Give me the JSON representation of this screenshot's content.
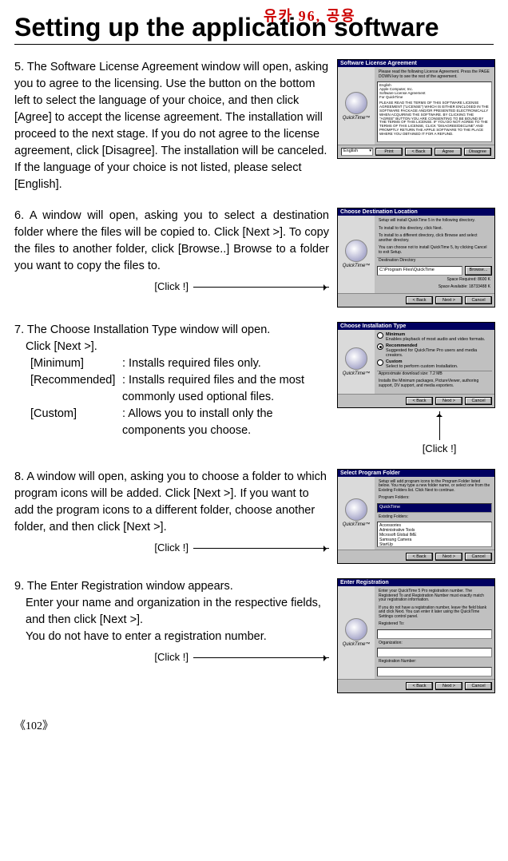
{
  "watermark": "유카 96, 공용",
  "title": "Setting up the application software",
  "steps": {
    "s5": {
      "num": "5.",
      "text": "The Software License Agreement window will open, asking you to agree to the licensing. Use the button on the bottom left to select the language of your choice, and then click [Agree] to accept the license agreement. The installation will proceed to the next stage. If you do not agree to the license agreement, click [Disagree]. The installation will be canceled. If the language of your choice is not listed, please select [English]."
    },
    "s6": {
      "num": "6.",
      "text": "A window will open, asking you to select a destination folder where the files will be copied to. Click [Next >]. To copy the files to another folder, click [Browse..] Browse to a folder you want to copy the files to.",
      "click": "[Click !]"
    },
    "s7": {
      "num": "7.",
      "line1": "The Choose Installation Type window will open.",
      "line2": "Click [Next >].",
      "options": [
        {
          "label": "[Minimum]",
          "desc": ": Installs required files only."
        },
        {
          "label": "[Recommended]",
          "desc": ": Installs required files and the most commonly used optional files."
        },
        {
          "label": "[Custom]",
          "desc": ": Allows you to install only the components you choose."
        }
      ],
      "click": "[Click !]"
    },
    "s8": {
      "num": "8.",
      "text": "A window will open, asking you to choose a folder to which program icons will be added. Click [Next >]. If you want to add the program icons to a different folder, choose another folder, and then click [Next >].",
      "click": "[Click !]"
    },
    "s9": {
      "num": "9.",
      "line1": "The Enter Registration window appears.",
      "line2": "Enter your name and organization in the respective fields, and then click [Next >].",
      "line3": "You do not have to enter a registration number.",
      "click": "[Click !]"
    }
  },
  "dialogs": {
    "d5": {
      "title": "Software License Agreement",
      "note": "Please read the following License Agreement. Press the PAGE DOWN key to see the rest of the agreement.",
      "license_top": "English\nApple Computer, Inc.\nSoftware License Agreement\nFor QuickTime",
      "license_body": "PLEASE READ THE TERMS OF THIS SOFTWARE LICENSE AGREEMENT (\"LICENSE\") WHICH IS EITHER ENCLOSED IN THE SOFTWARE PACKAGE AND/OR PRESENTED ELECTRONICALLY WHEN ACQUIRING THE SOFTWARE. BY CLICKING THE \"AGREE\" BUTTON YOU ARE CONSENTING TO BE BOUND BY THE TERMS OF THIS LICENSE. IF YOU DO NOT AGREE TO THE TERMS OF THIS LICENSE, CLICK \"DISAGREE/DECLINE\" AND PROMPTLY RETURN THE APPLE SOFTWARE TO THE PLACE WHERE YOU OBTAINED IT FOR A REFUND.",
      "lang": "English",
      "buttons": [
        "Print",
        "< Back",
        "Agree",
        "Disagree"
      ],
      "qt": "QuickTime™"
    },
    "d6": {
      "title": "Choose Destination Location",
      "note1": "Setup will install QuickTime 5 in the following directory.",
      "note2": "To install to this directory, click Next.",
      "note3": "To install to a different directory, click Browse and select another directory.",
      "note4": "You can choose not to install QuickTime 5, by clicking Cancel to exit Setup.",
      "dest_label": "Destination Directory",
      "dest_path": "C:\\Program Files\\QuickTime",
      "browse": "Browse...",
      "space1": "Space Required:   8600 K",
      "space2": "Space Available:  18733488 K",
      "buttons": [
        "< Back",
        "Next >",
        "Cancel"
      ],
      "qt": "QuickTime™"
    },
    "d7": {
      "title": "Choose Installation Type",
      "opt1_title": "Minimum",
      "opt1_desc": "Enables playback of most audio and video formats.",
      "opt2_title": "Recommended",
      "opt2_desc": "Suggested for QuickTime Pro users and media creators.",
      "opt3_title": "Custom",
      "opt3_desc": "Select to perform custom Installation.",
      "approx": "Approximate download size: 7.2 MB",
      "installs": "Installs the Minimum packages, PictureViewer, authoring support, DV support, and media exporters.",
      "buttons": [
        "< Back",
        "Next >",
        "Cancel"
      ],
      "qt": "QuickTime™"
    },
    "d8": {
      "title": "Select Program Folder",
      "note": "Setup will add program icons to the Program Folder listed below. You may type a new folder name, or select one from the Existing Folders list. Click Next to continue.",
      "pf_label": "Program Folders:",
      "pf_value": "QuickTime",
      "ef_label": "Existing Folders:",
      "ef_items": [
        "Accessories",
        "Administrative Tools",
        "Microsoft Global IME",
        "Samsung Camera",
        "StartUp"
      ],
      "buttons": [
        "< Back",
        "Next >",
        "Cancel"
      ],
      "qt": "QuickTime™"
    },
    "d9": {
      "title": "Enter Registration",
      "note1": "Enter your QuickTime 5 Pro registration number. The Registered To and Registration Number must exactly match your registration information.",
      "note2": "If you do not have a registration number, leave the field blank and click Next. You can enter it later using the QuickTime Settings control panel.",
      "f1": "Registered To:",
      "f2": "Organization:",
      "f3": "Registration Number:",
      "buttons": [
        "< Back",
        "Next >",
        "Cancel"
      ],
      "qt": "QuickTime™"
    }
  },
  "page_number": "102"
}
